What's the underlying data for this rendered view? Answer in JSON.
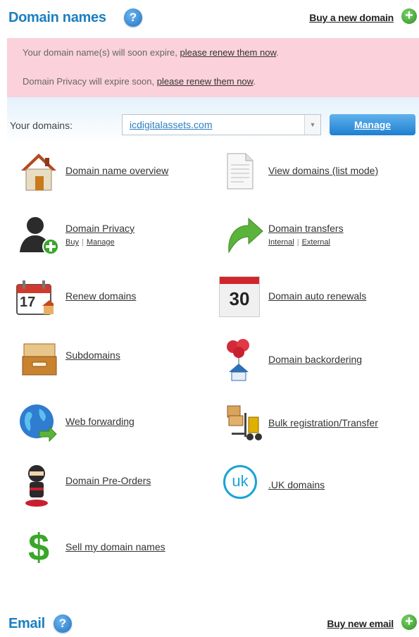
{
  "header": {
    "title": "Domain names",
    "help_glyph": "?",
    "buy_link": "Buy a new domain",
    "add_glyph": "+"
  },
  "alerts": {
    "line1_text": "Your domain name(s) will soon expire,",
    "line1_link": "please renew them now",
    "line1_end": ".",
    "line2_text": "Domain Privacy will expire soon,",
    "line2_link": "please renew them now",
    "line2_end": "."
  },
  "domains_bar": {
    "label": "Your domains:",
    "selected_domain": "icdigitalassets.com",
    "dropdown_glyph": "▼",
    "manage_button": "Manage"
  },
  "items": {
    "overview": {
      "label": "Domain name overview",
      "icon": "house-icon"
    },
    "view_list": {
      "label": "View domains (list mode)",
      "icon": "document-icon"
    },
    "privacy": {
      "label": "Domain Privacy",
      "sub_buy": "Buy",
      "sub_sep": "|",
      "sub_manage": "Manage",
      "icon": "user-add-icon"
    },
    "transfers": {
      "label": "Domain transfers",
      "sub_internal": "Internal",
      "sub_sep": "|",
      "sub_external": "External",
      "icon": "transfer-arrow-icon"
    },
    "renew": {
      "label": "Renew domains",
      "icon": "calendar-renew-icon",
      "icon_text": "17"
    },
    "auto_renew": {
      "label": "Domain auto renewals",
      "icon": "calendar-icon",
      "icon_text": "30"
    },
    "subdomains": {
      "label": "Subdomains",
      "icon": "drawer-icon"
    },
    "backorder": {
      "label": "Domain backordering",
      "icon": "balloon-house-icon"
    },
    "forwarding": {
      "label": "Web forwarding",
      "icon": "globe-arrow-icon"
    },
    "bulk": {
      "label": "Bulk registration/Transfer",
      "icon": "forklift-icon"
    },
    "preorders": {
      "label": "Domain Pre-Orders",
      "icon": "ninja-icon"
    },
    "uk": {
      "label": ".UK domains",
      "icon": "uk-logo-icon",
      "icon_text": "uk"
    },
    "sell": {
      "label": "Sell my domain names",
      "icon": "dollar-icon",
      "icon_text": "$"
    }
  },
  "email_header": {
    "title": "Email",
    "help_glyph": "?",
    "buy_link": "Buy new email",
    "add_glyph": "+"
  }
}
